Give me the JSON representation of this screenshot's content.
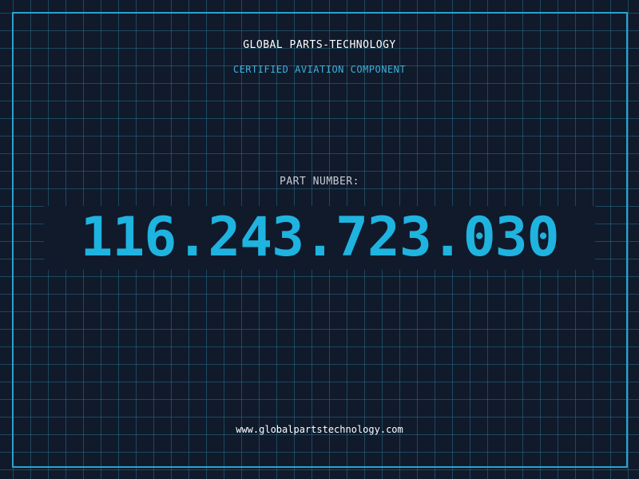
{
  "header": {
    "company": "GLOBAL PARTS-TECHNOLOGY",
    "subtitle": "CERTIFIED AVIATION COMPONENT"
  },
  "part": {
    "label": "PART NUMBER:",
    "number": "116.243.723.030"
  },
  "footer": {
    "website": "www.globalpartstechnology.com"
  },
  "colors": {
    "background": "#101a2b",
    "grid": "#286e8c",
    "accent": "#1fb3e0",
    "frame": "#2aa3cc"
  }
}
